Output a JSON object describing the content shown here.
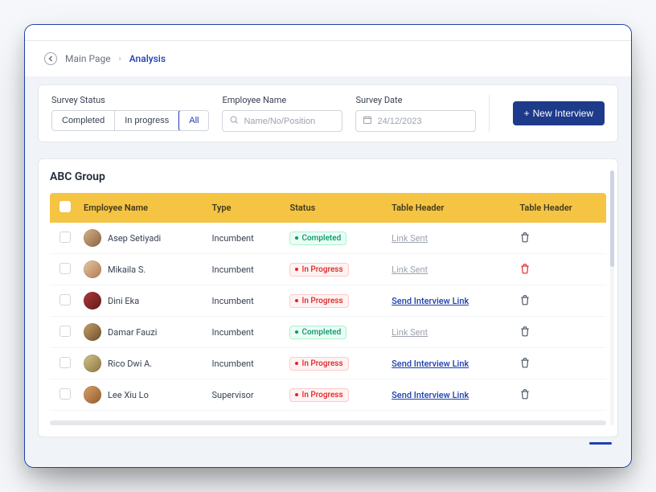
{
  "breadcrumb": {
    "parent": "Main Page",
    "current": "Analysis"
  },
  "filters": {
    "survey_status_label": "Survey Status",
    "status_options": {
      "completed": "Completed",
      "in_progress": "In progress",
      "all": "All"
    },
    "employee_name_label": "Employee Name",
    "employee_name_placeholder": "Name/No/Position",
    "survey_date_label": "Survey Date",
    "survey_date_value": "24/12/2023",
    "new_interview_label": "New Interview"
  },
  "group": {
    "title": "ABC Group"
  },
  "table": {
    "headers": {
      "employee": "Employee Name",
      "type": "Type",
      "status": "Status",
      "col4": "Table Header",
      "col5": "Table Header"
    },
    "status_labels": {
      "completed": "Completed",
      "in_progress": "In Progress"
    },
    "link_labels": {
      "sent": "Link Sent",
      "send": "Send Interview Link"
    },
    "rows": [
      {
        "name": "Asep Setiyadi",
        "type": "Incumbent",
        "status": "completed",
        "link": "sent",
        "trash_danger": false
      },
      {
        "name": "Mikaila S.",
        "type": "Incumbent",
        "status": "in_progress",
        "link": "sent",
        "trash_danger": true
      },
      {
        "name": "Dini Eka",
        "type": "Incumbent",
        "status": "in_progress",
        "link": "send",
        "trash_danger": false
      },
      {
        "name": "Damar Fauzi",
        "type": "Incumbent",
        "status": "completed",
        "link": "sent",
        "trash_danger": false
      },
      {
        "name": "Rico Dwi A.",
        "type": "Incumbent",
        "status": "in_progress",
        "link": "send",
        "trash_danger": false
      },
      {
        "name": "Lee Xiu Lo",
        "type": "Supervisor",
        "status": "in_progress",
        "link": "send",
        "trash_danger": false
      }
    ]
  },
  "avatar_gradients": [
    "linear-gradient(135deg,#d6b48a,#8a6240)",
    "linear-gradient(135deg,#e9c7a5,#b07b52)",
    "linear-gradient(135deg,#b33939,#5d1a1a)",
    "linear-gradient(135deg,#c5a16a,#6e4e2a)",
    "linear-gradient(135deg,#d6c28a,#8a7640)",
    "linear-gradient(135deg,#d9a06b,#945c2b)"
  ]
}
